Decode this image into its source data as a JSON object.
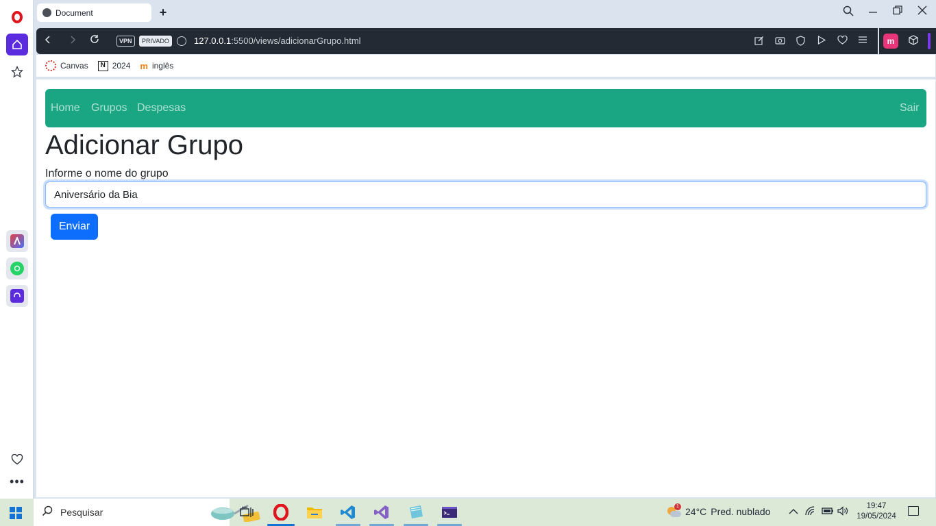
{
  "browser": {
    "tab_title": "Document",
    "new_tab_symbol": "+",
    "url_host": "127.0.0.1",
    "url_rest": ":5500/views/adicionarGrupo.html",
    "vpn_label": "VPN",
    "private_label": "PRIVADO",
    "extension_m_label": "m"
  },
  "bookmarks": [
    {
      "label": "Canvas",
      "icon": "canvas-icon"
    },
    {
      "label": "2024",
      "icon": "notion-icon",
      "icon_text": "N"
    },
    {
      "label": "inglês",
      "icon": "moodle-icon",
      "icon_text": "m"
    }
  ],
  "navbar": {
    "links": [
      "Home",
      "Grupos",
      "Despesas"
    ],
    "logout": "Sair",
    "color": "#1aa682"
  },
  "page": {
    "title": "Adicionar Grupo",
    "label": "Informe o nome do grupo",
    "input_value": "Aniversário da Bia",
    "submit_label": "Enviar",
    "button_color": "#0d6efd"
  },
  "taskbar": {
    "search_placeholder": "Pesquisar",
    "temperature": "24°C",
    "weather_text": "Pred. nublado",
    "weather_badge": "1",
    "time": "19:47",
    "date": "19/05/2024"
  }
}
